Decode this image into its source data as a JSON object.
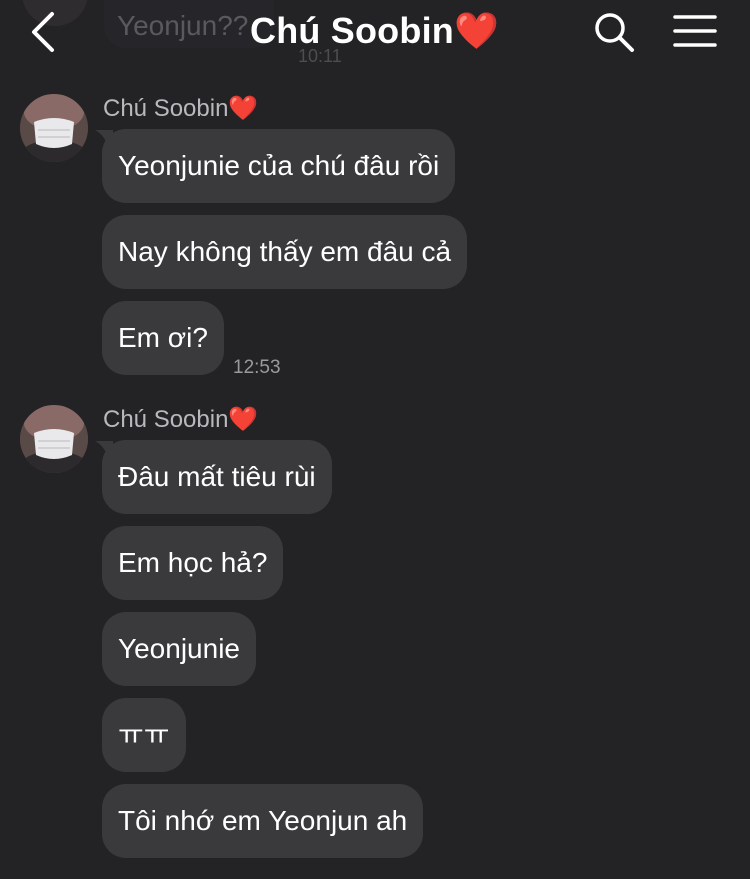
{
  "header": {
    "title": "Chú Soobin❤️",
    "prev_message_text": "Yeonjun??",
    "prev_message_time": "10:11"
  },
  "groups": [
    {
      "sender": "Chú Soobin❤️",
      "messages": [
        "Yeonjunie của chú đâu rồi",
        "Nay không thấy em đâu cả",
        "Em ơi?"
      ],
      "time": "12:53"
    },
    {
      "sender": "Chú Soobin❤️",
      "messages": [
        "Đâu mất tiêu rùi",
        "Em học hả?",
        "Yeonjunie",
        "ㅠㅠ",
        "Tôi nhớ em Yeonjun ah"
      ]
    }
  ],
  "icons": {
    "back": "chevron-left-icon",
    "search": "search-icon",
    "menu": "hamburger-menu-icon"
  },
  "colors": {
    "background": "#232326",
    "bubble": "#3a3a3d",
    "text": "#ffffff",
    "muted": "#b9b9bd"
  }
}
